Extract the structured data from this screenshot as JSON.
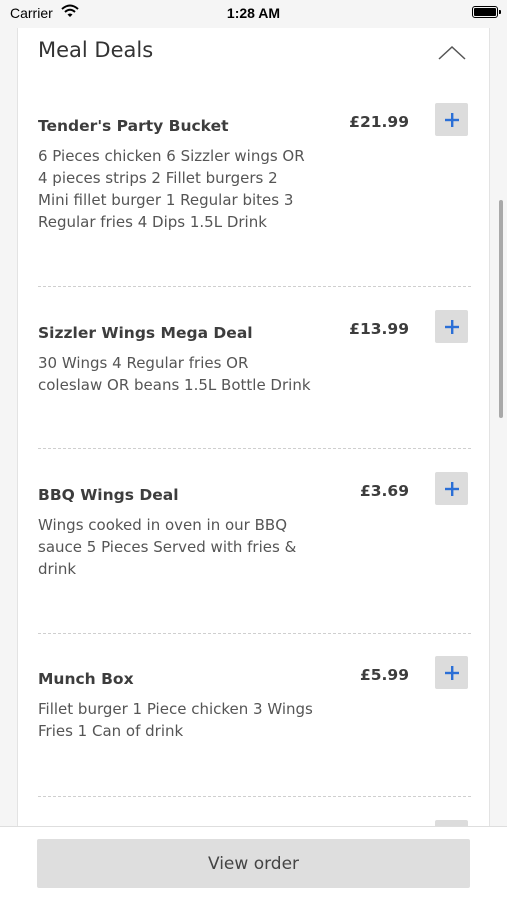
{
  "status_bar": {
    "carrier": "Carrier",
    "time": "1:28 AM"
  },
  "section": {
    "title": "Meal Deals",
    "collapse_icon": "chevron-up-icon"
  },
  "items": [
    {
      "name": "Tender's Party Bucket",
      "price": "£21.99",
      "description": "6 Pieces chicken 6 Sizzler wings OR 4 pieces strips 2 Fillet burgers 2 Mini fillet burger 1 Regular bites 3 Regular fries 4 Dips 1.5L Drink",
      "add_icon": "plus-icon"
    },
    {
      "name": "Sizzler Wings Mega Deal",
      "price": "£13.99",
      "description": "30 Wings 4 Regular fries OR coleslaw OR beans 1.5L Bottle Drink",
      "add_icon": "plus-icon"
    },
    {
      "name": "BBQ Wings Deal",
      "price": "£3.69",
      "description": "Wings cooked in oven in our BBQ sauce 5 Pieces Served with fries & drink",
      "add_icon": "plus-icon"
    },
    {
      "name": "Munch Box",
      "price": "£5.99",
      "description": "Fillet burger 1 Piece chicken 3 Wings Fries 1 Can of drink",
      "add_icon": "plus-icon"
    }
  ],
  "footer": {
    "view_order_label": "View order"
  },
  "colors": {
    "accent": "#2b6fd6",
    "button_bg": "#dcdcdc"
  }
}
